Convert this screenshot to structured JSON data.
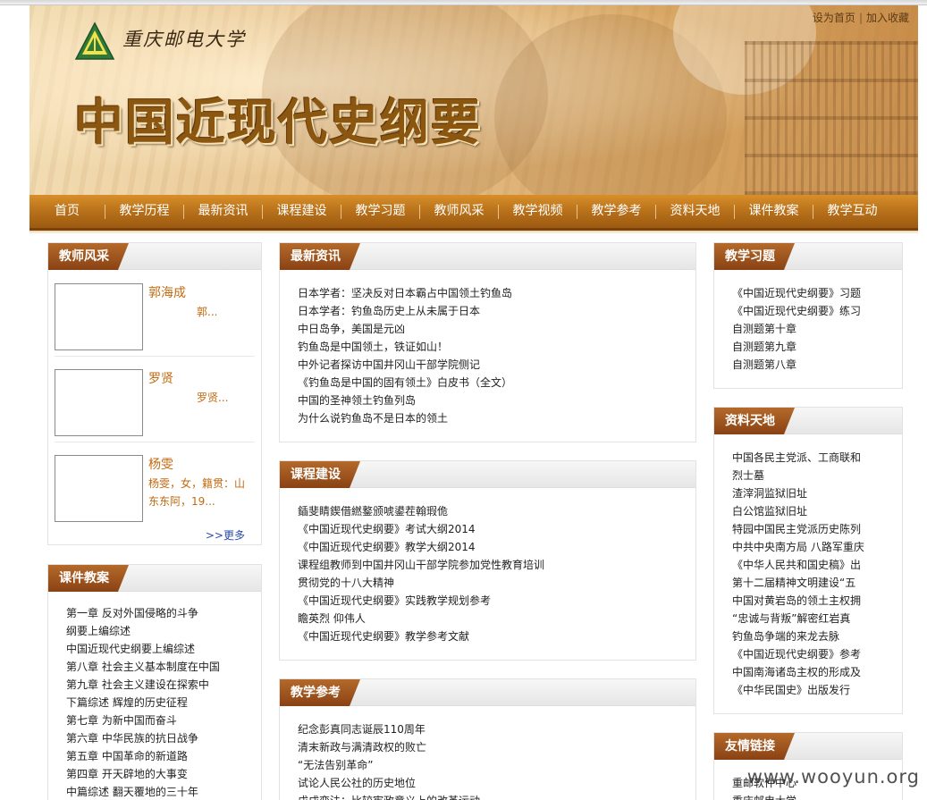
{
  "header": {
    "top_links": [
      "设为首页",
      "加入收藏"
    ],
    "top_link_separator": "|",
    "school_name": "重庆邮电大学",
    "site_title": "中国近现代史纲要",
    "colors": {
      "nav": "#b8701a",
      "panel_tab": "#9a5218",
      "link_accent": "#c26a10"
    }
  },
  "nav": {
    "items": [
      "首页",
      "教学历程",
      "最新资讯",
      "课程建设",
      "教学习题",
      "教师风采",
      "教学视频",
      "教学参考",
      "资料天地",
      "课件教案",
      "教学互动"
    ]
  },
  "teachers": {
    "title": "教师风采",
    "items": [
      {
        "name": "郭海成",
        "desc": "郭..."
      },
      {
        "name": "罗贤",
        "desc": "罗贤..."
      },
      {
        "name": "杨雯",
        "desc": "杨雯，女，籍贯：山东东阿，19..."
      }
    ],
    "more": ">>更多"
  },
  "courseware": {
    "title": "课件教案",
    "items": [
      "第一章 反对外国侵略的斗争",
      "纲要上编综述",
      "中国近现代史纲要上编综述",
      "第八章 社会主义基本制度在中国",
      "第九章 社会主义建设在探索中",
      "下篇综述 辉煌的历史征程",
      "第七章 为新中国而奋斗",
      "第六章 中华民族的抗日战争",
      "第五章 中国革命的新道路",
      "第四章 开天辟地的大事变",
      "中篇综述 翻天覆地的三十年"
    ]
  },
  "news": {
    "title": "最新资讯",
    "items": [
      "日本学者：坚决反对日本霸占中国领土钓鱼岛",
      "日本学者：钓鱼岛历史上从未属于日本",
      "中日岛争，美国是元凶",
      "钓鱼岛是中国领土，铁证如山！",
      "中外记者探访中国井冈山干部学院侧记",
      "《钓鱼岛是中国的固有领土》白皮书（全文）",
      "中国的圣神领土钓鱼列岛",
      "为什么说钓鱼岛不是日本的领土"
    ]
  },
  "course": {
    "title": "课程建设",
    "items": [
      "鍤斐睛鍥借繎鐜颁唬鍙茬翰瑕佹",
      "《中国近现代史纲要》考试大纲2014",
      "《中国近现代史纲要》教学大纲2014",
      "课程组教师到中国井冈山干部学院参加党性教育培训",
      "贯彻党的十八大精神",
      "《中国近现代史纲要》实践教学规划参考",
      "瞻英烈 仰伟人",
      "《中国近现代史纲要》教学参考文献"
    ]
  },
  "reference": {
    "title": "教学参考",
    "items": [
      "纪念彭真同志诞辰110周年",
      "清末新政与满清政权的败亡",
      "“无法告别革命”",
      "试论人民公社的历史地位",
      "戊戌变法：比较宪政意义上的改革运动"
    ]
  },
  "exercises": {
    "title": "教学习题",
    "items": [
      "《中国近现代史纲要》习题",
      "《中国近现代史纲要》练习",
      "自测题第十章",
      "自测题第九章",
      "自测题第八章"
    ]
  },
  "materials": {
    "title": "资料天地",
    "items": [
      "中国各民主党派、工商联和",
      "烈士墓",
      "渣滓洞监狱旧址",
      "白公馆监狱旧址",
      "特园中国民主党派历史陈列",
      "中共中央南方局 八路军重庆",
      "《中华人民共和国史稿》出",
      "第十二届精神文明建设“五",
      "中国对黄岩岛的领土主权拥",
      "“忠诚与背叛”解密红岩真",
      "钓鱼岛争端的来龙去脉",
      "《中国近现代史纲要》参考",
      "中国南海诸岛主权的形成及",
      "《中华民国史》出版发行"
    ]
  },
  "links": {
    "title": "友情链接",
    "items": [
      "重邮软件中心",
      "重庆邮电大学"
    ]
  },
  "watermark": "www.wooyun.org"
}
